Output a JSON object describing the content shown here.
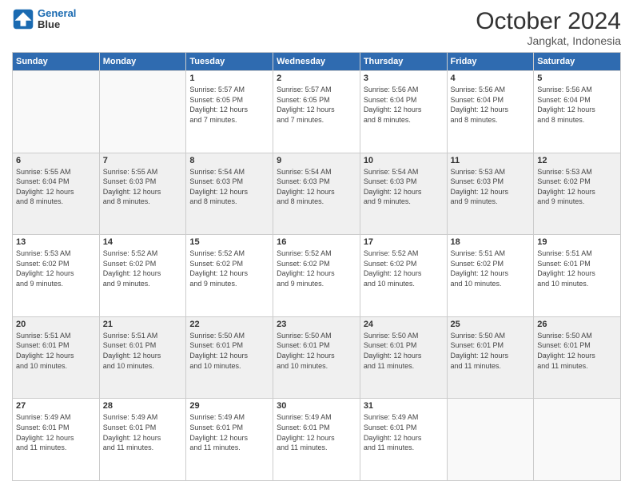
{
  "logo": {
    "line1": "General",
    "line2": "Blue"
  },
  "title": "October 2024",
  "location": "Jangkat, Indonesia",
  "days_header": [
    "Sunday",
    "Monday",
    "Tuesday",
    "Wednesday",
    "Thursday",
    "Friday",
    "Saturday"
  ],
  "weeks": [
    {
      "shaded": false,
      "days": [
        {
          "num": "",
          "info": ""
        },
        {
          "num": "",
          "info": ""
        },
        {
          "num": "1",
          "info": "Sunrise: 5:57 AM\nSunset: 6:05 PM\nDaylight: 12 hours\nand 7 minutes."
        },
        {
          "num": "2",
          "info": "Sunrise: 5:57 AM\nSunset: 6:05 PM\nDaylight: 12 hours\nand 7 minutes."
        },
        {
          "num": "3",
          "info": "Sunrise: 5:56 AM\nSunset: 6:04 PM\nDaylight: 12 hours\nand 8 minutes."
        },
        {
          "num": "4",
          "info": "Sunrise: 5:56 AM\nSunset: 6:04 PM\nDaylight: 12 hours\nand 8 minutes."
        },
        {
          "num": "5",
          "info": "Sunrise: 5:56 AM\nSunset: 6:04 PM\nDaylight: 12 hours\nand 8 minutes."
        }
      ]
    },
    {
      "shaded": true,
      "days": [
        {
          "num": "6",
          "info": "Sunrise: 5:55 AM\nSunset: 6:04 PM\nDaylight: 12 hours\nand 8 minutes."
        },
        {
          "num": "7",
          "info": "Sunrise: 5:55 AM\nSunset: 6:03 PM\nDaylight: 12 hours\nand 8 minutes."
        },
        {
          "num": "8",
          "info": "Sunrise: 5:54 AM\nSunset: 6:03 PM\nDaylight: 12 hours\nand 8 minutes."
        },
        {
          "num": "9",
          "info": "Sunrise: 5:54 AM\nSunset: 6:03 PM\nDaylight: 12 hours\nand 8 minutes."
        },
        {
          "num": "10",
          "info": "Sunrise: 5:54 AM\nSunset: 6:03 PM\nDaylight: 12 hours\nand 9 minutes."
        },
        {
          "num": "11",
          "info": "Sunrise: 5:53 AM\nSunset: 6:03 PM\nDaylight: 12 hours\nand 9 minutes."
        },
        {
          "num": "12",
          "info": "Sunrise: 5:53 AM\nSunset: 6:02 PM\nDaylight: 12 hours\nand 9 minutes."
        }
      ]
    },
    {
      "shaded": false,
      "days": [
        {
          "num": "13",
          "info": "Sunrise: 5:53 AM\nSunset: 6:02 PM\nDaylight: 12 hours\nand 9 minutes."
        },
        {
          "num": "14",
          "info": "Sunrise: 5:52 AM\nSunset: 6:02 PM\nDaylight: 12 hours\nand 9 minutes."
        },
        {
          "num": "15",
          "info": "Sunrise: 5:52 AM\nSunset: 6:02 PM\nDaylight: 12 hours\nand 9 minutes."
        },
        {
          "num": "16",
          "info": "Sunrise: 5:52 AM\nSunset: 6:02 PM\nDaylight: 12 hours\nand 9 minutes."
        },
        {
          "num": "17",
          "info": "Sunrise: 5:52 AM\nSunset: 6:02 PM\nDaylight: 12 hours\nand 10 minutes."
        },
        {
          "num": "18",
          "info": "Sunrise: 5:51 AM\nSunset: 6:02 PM\nDaylight: 12 hours\nand 10 minutes."
        },
        {
          "num": "19",
          "info": "Sunrise: 5:51 AM\nSunset: 6:01 PM\nDaylight: 12 hours\nand 10 minutes."
        }
      ]
    },
    {
      "shaded": true,
      "days": [
        {
          "num": "20",
          "info": "Sunrise: 5:51 AM\nSunset: 6:01 PM\nDaylight: 12 hours\nand 10 minutes."
        },
        {
          "num": "21",
          "info": "Sunrise: 5:51 AM\nSunset: 6:01 PM\nDaylight: 12 hours\nand 10 minutes."
        },
        {
          "num": "22",
          "info": "Sunrise: 5:50 AM\nSunset: 6:01 PM\nDaylight: 12 hours\nand 10 minutes."
        },
        {
          "num": "23",
          "info": "Sunrise: 5:50 AM\nSunset: 6:01 PM\nDaylight: 12 hours\nand 10 minutes."
        },
        {
          "num": "24",
          "info": "Sunrise: 5:50 AM\nSunset: 6:01 PM\nDaylight: 12 hours\nand 11 minutes."
        },
        {
          "num": "25",
          "info": "Sunrise: 5:50 AM\nSunset: 6:01 PM\nDaylight: 12 hours\nand 11 minutes."
        },
        {
          "num": "26",
          "info": "Sunrise: 5:50 AM\nSunset: 6:01 PM\nDaylight: 12 hours\nand 11 minutes."
        }
      ]
    },
    {
      "shaded": false,
      "days": [
        {
          "num": "27",
          "info": "Sunrise: 5:49 AM\nSunset: 6:01 PM\nDaylight: 12 hours\nand 11 minutes."
        },
        {
          "num": "28",
          "info": "Sunrise: 5:49 AM\nSunset: 6:01 PM\nDaylight: 12 hours\nand 11 minutes."
        },
        {
          "num": "29",
          "info": "Sunrise: 5:49 AM\nSunset: 6:01 PM\nDaylight: 12 hours\nand 11 minutes."
        },
        {
          "num": "30",
          "info": "Sunrise: 5:49 AM\nSunset: 6:01 PM\nDaylight: 12 hours\nand 11 minutes."
        },
        {
          "num": "31",
          "info": "Sunrise: 5:49 AM\nSunset: 6:01 PM\nDaylight: 12 hours\nand 11 minutes."
        },
        {
          "num": "",
          "info": ""
        },
        {
          "num": "",
          "info": ""
        }
      ]
    }
  ]
}
